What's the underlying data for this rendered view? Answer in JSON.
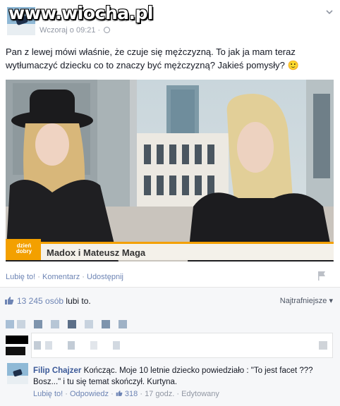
{
  "watermark": "www.wiocha.pl",
  "post": {
    "timestamp": "Wczoraj o 09:21",
    "text": "Pan z lewej mówi właśnie, że czuje się mężczyzną. To jak ja mam teraz wytłumaczyć dziecku co to znaczy być mężczyzną? Jakieś pomysły? 🙂",
    "photo_caption": "Madox i Mateusz Maga",
    "photo_logo": "dzień dobry"
  },
  "actions": {
    "like": "Lubię to!",
    "comment": "Komentarz",
    "share": "Udostępnij",
    "separator": "·"
  },
  "likes": {
    "count": "13 245 osób",
    "suffix": " lubi to.",
    "sort": "Najtrafniejsze"
  },
  "comment": {
    "author": "Filip Chajzer",
    "text": "Kończąc. Moje 10 letnie dziecko powiedziało : \"To jest facet ??? Bosz...\" i tu się temat skończył. Kurtyna.",
    "like": "Lubię to!",
    "reply": "Odpowiedz",
    "likes": "318",
    "time": "17 godz.",
    "edited": "Edytowany",
    "separator": "·"
  },
  "colors": {
    "link": "#3b5998",
    "meta": "#9197a3",
    "caption_bar": "#f3a000"
  }
}
